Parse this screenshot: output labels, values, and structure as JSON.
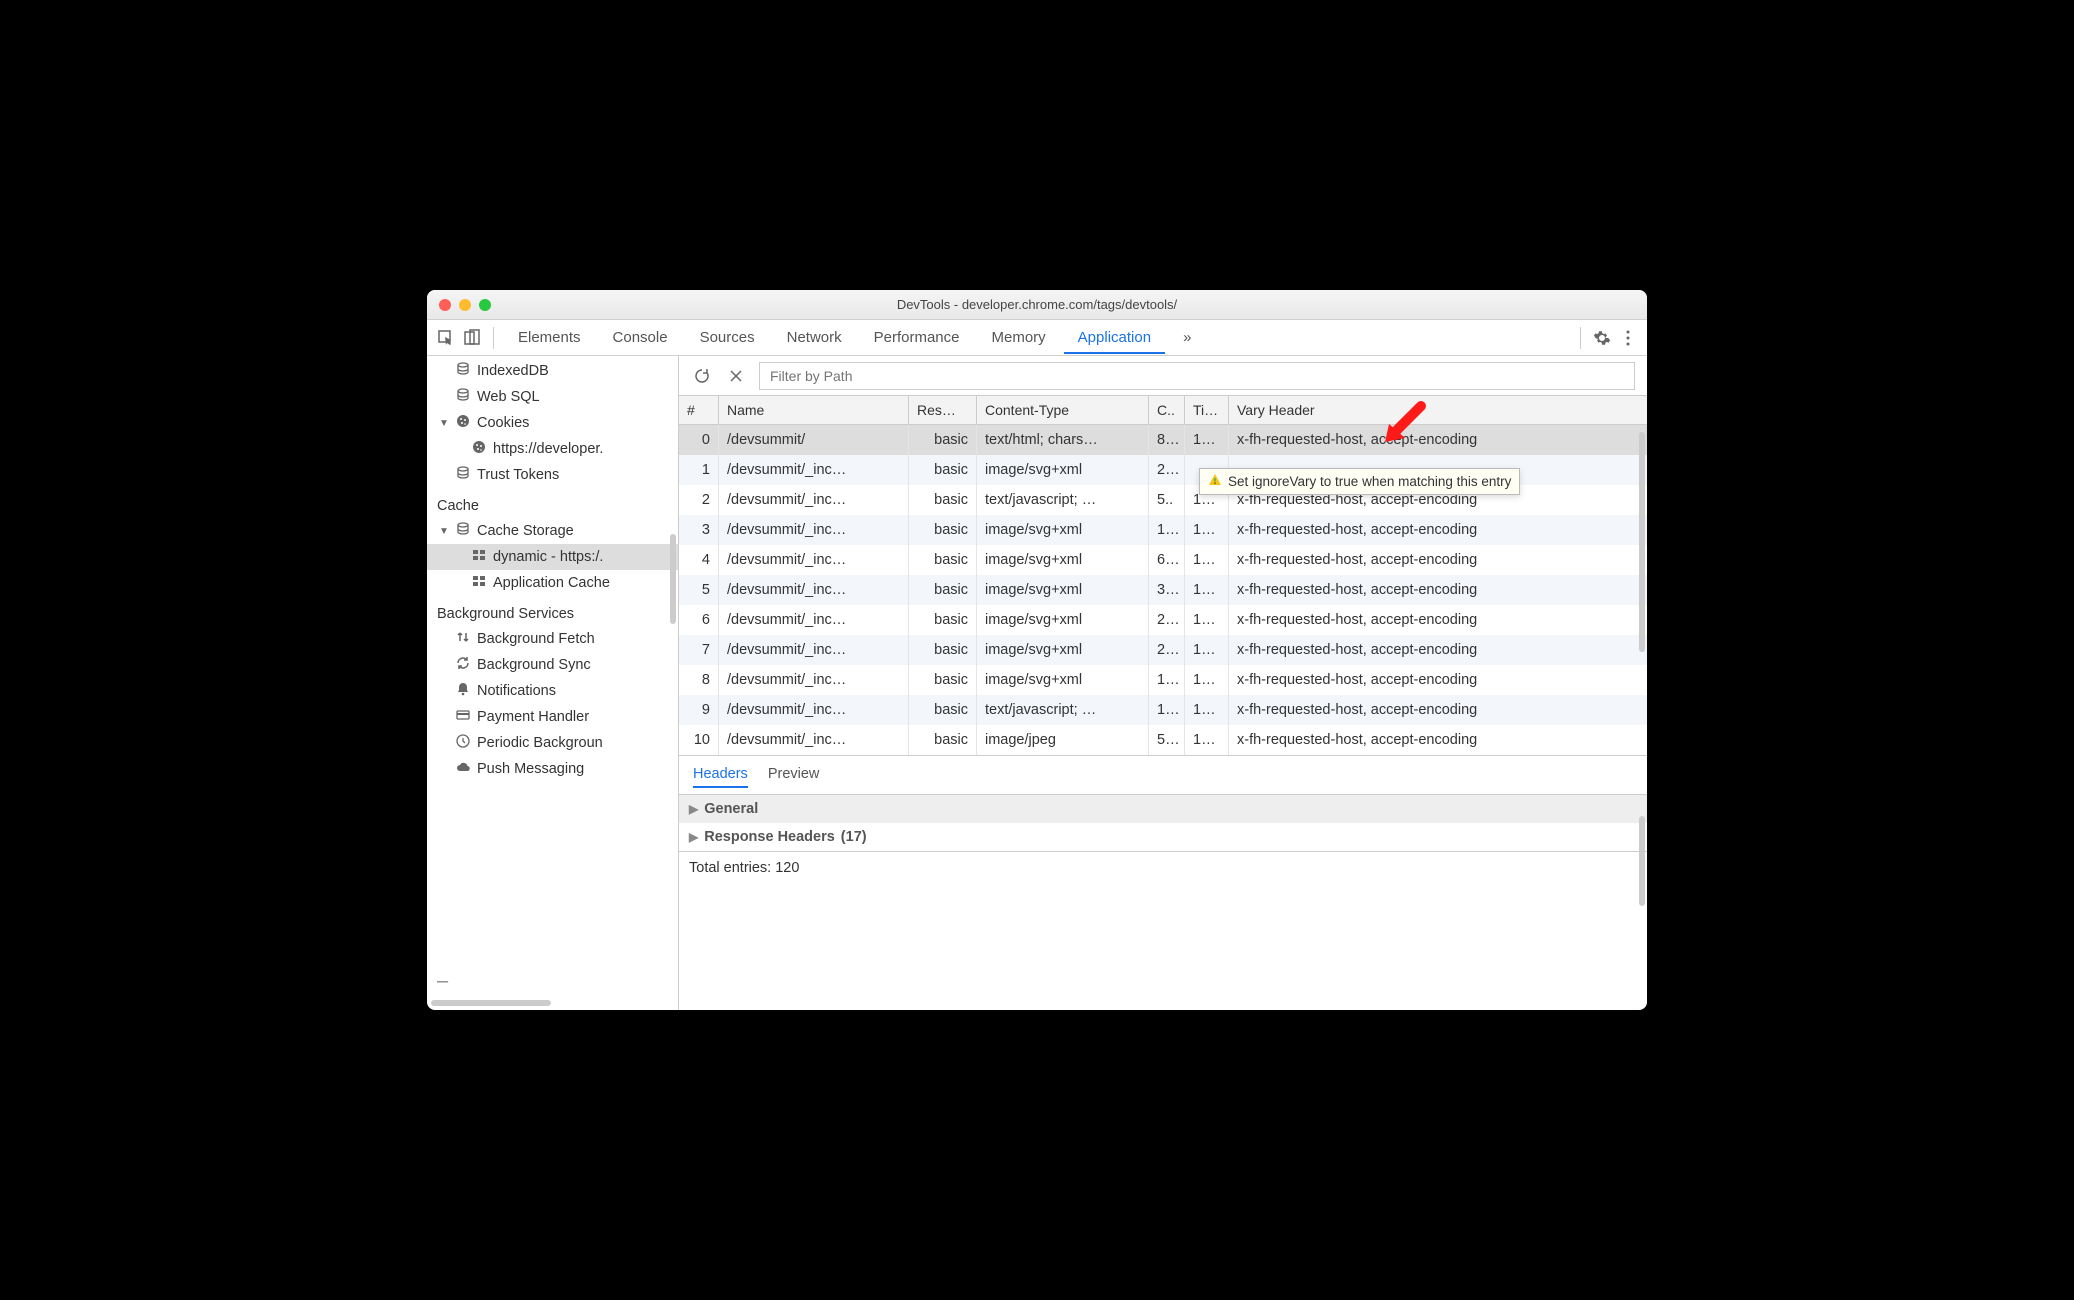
{
  "window": {
    "title": "DevTools - developer.chrome.com/tags/devtools/"
  },
  "tabs": {
    "items": [
      "Elements",
      "Console",
      "Sources",
      "Network",
      "Performance",
      "Memory",
      "Application"
    ],
    "active": "Application",
    "overflow": "»"
  },
  "sidebar": {
    "storage_items": [
      {
        "icon": "db",
        "label": "IndexedDB",
        "indent": "l2",
        "truncated": true
      },
      {
        "icon": "db",
        "label": "Web SQL",
        "indent": "l2"
      },
      {
        "icon": "cookie",
        "label": "Cookies",
        "indent": "l1",
        "expandable": true,
        "expanded": true
      },
      {
        "icon": "cookie",
        "label": "https://developer.",
        "indent": "l3",
        "ellipsis": true
      },
      {
        "icon": "db",
        "label": "Trust Tokens",
        "indent": "l2"
      }
    ],
    "cache_title": "Cache",
    "cache_items": [
      {
        "icon": "db",
        "label": "Cache Storage",
        "indent": "l1",
        "expandable": true,
        "expanded": true
      },
      {
        "icon": "grid",
        "label": "dynamic - https:/.",
        "indent": "l3",
        "selected": true,
        "ellipsis": true
      },
      {
        "icon": "grid",
        "label": "Application Cache",
        "indent": "l3"
      }
    ],
    "bg_title": "Background Services",
    "bg_items": [
      {
        "icon": "updown",
        "label": "Background Fetch"
      },
      {
        "icon": "sync",
        "label": "Background Sync"
      },
      {
        "icon": "bell",
        "label": "Notifications"
      },
      {
        "icon": "card",
        "label": "Payment Handler"
      },
      {
        "icon": "clock",
        "label": "Periodic Backgroun",
        "ellipsis": true
      },
      {
        "icon": "cloud",
        "label": "Push Messaging"
      }
    ]
  },
  "toolbar": {
    "filter_placeholder": "Filter by Path"
  },
  "table": {
    "headers": {
      "idx": "#",
      "name": "Name",
      "response": "Res…",
      "content_type": "Content-Type",
      "content_length": "C..",
      "time_cached": "Ti…",
      "vary": "Vary Header"
    },
    "rows": [
      {
        "idx": "0",
        "name": "/devsummit/",
        "res": "basic",
        "ct": "text/html; chars…",
        "cl": "8…",
        "tc": "1…",
        "vh": "x-fh-requested-host, accept-encoding",
        "selected": true
      },
      {
        "idx": "1",
        "name": "/devsummit/_inc…",
        "res": "basic",
        "ct": "image/svg+xml",
        "cl": "2…",
        "tc": "",
        "vh": ""
      },
      {
        "idx": "2",
        "name": "/devsummit/_inc…",
        "res": "basic",
        "ct": "text/javascript; …",
        "cl": "5..",
        "tc": "1…",
        "vh": "x-fh-requested-host, accept-encoding"
      },
      {
        "idx": "3",
        "name": "/devsummit/_inc…",
        "res": "basic",
        "ct": "image/svg+xml",
        "cl": "1…",
        "tc": "1…",
        "vh": "x-fh-requested-host, accept-encoding"
      },
      {
        "idx": "4",
        "name": "/devsummit/_inc…",
        "res": "basic",
        "ct": "image/svg+xml",
        "cl": "6…",
        "tc": "1…",
        "vh": "x-fh-requested-host, accept-encoding"
      },
      {
        "idx": "5",
        "name": "/devsummit/_inc…",
        "res": "basic",
        "ct": "image/svg+xml",
        "cl": "3…",
        "tc": "1…",
        "vh": "x-fh-requested-host, accept-encoding"
      },
      {
        "idx": "6",
        "name": "/devsummit/_inc…",
        "res": "basic",
        "ct": "image/svg+xml",
        "cl": "2…",
        "tc": "1…",
        "vh": "x-fh-requested-host, accept-encoding"
      },
      {
        "idx": "7",
        "name": "/devsummit/_inc…",
        "res": "basic",
        "ct": "image/svg+xml",
        "cl": "2…",
        "tc": "1…",
        "vh": "x-fh-requested-host, accept-encoding"
      },
      {
        "idx": "8",
        "name": "/devsummit/_inc…",
        "res": "basic",
        "ct": "image/svg+xml",
        "cl": "1…",
        "tc": "1…",
        "vh": "x-fh-requested-host, accept-encoding"
      },
      {
        "idx": "9",
        "name": "/devsummit/_inc…",
        "res": "basic",
        "ct": "text/javascript; …",
        "cl": "1…",
        "tc": "1…",
        "vh": "x-fh-requested-host, accept-encoding"
      },
      {
        "idx": "10",
        "name": "/devsummit/_inc…",
        "res": "basic",
        "ct": "image/jpeg",
        "cl": "5…",
        "tc": "1…",
        "vh": "x-fh-requested-host, accept-encoding"
      }
    ]
  },
  "details": {
    "tabs": {
      "headers": "Headers",
      "preview": "Preview",
      "active": "Headers"
    },
    "general": "General",
    "response_headers": "Response Headers",
    "response_count": "(17)",
    "total": "Total entries: 120"
  },
  "tooltip": {
    "text": "Set ignoreVary to true when matching this entry"
  }
}
